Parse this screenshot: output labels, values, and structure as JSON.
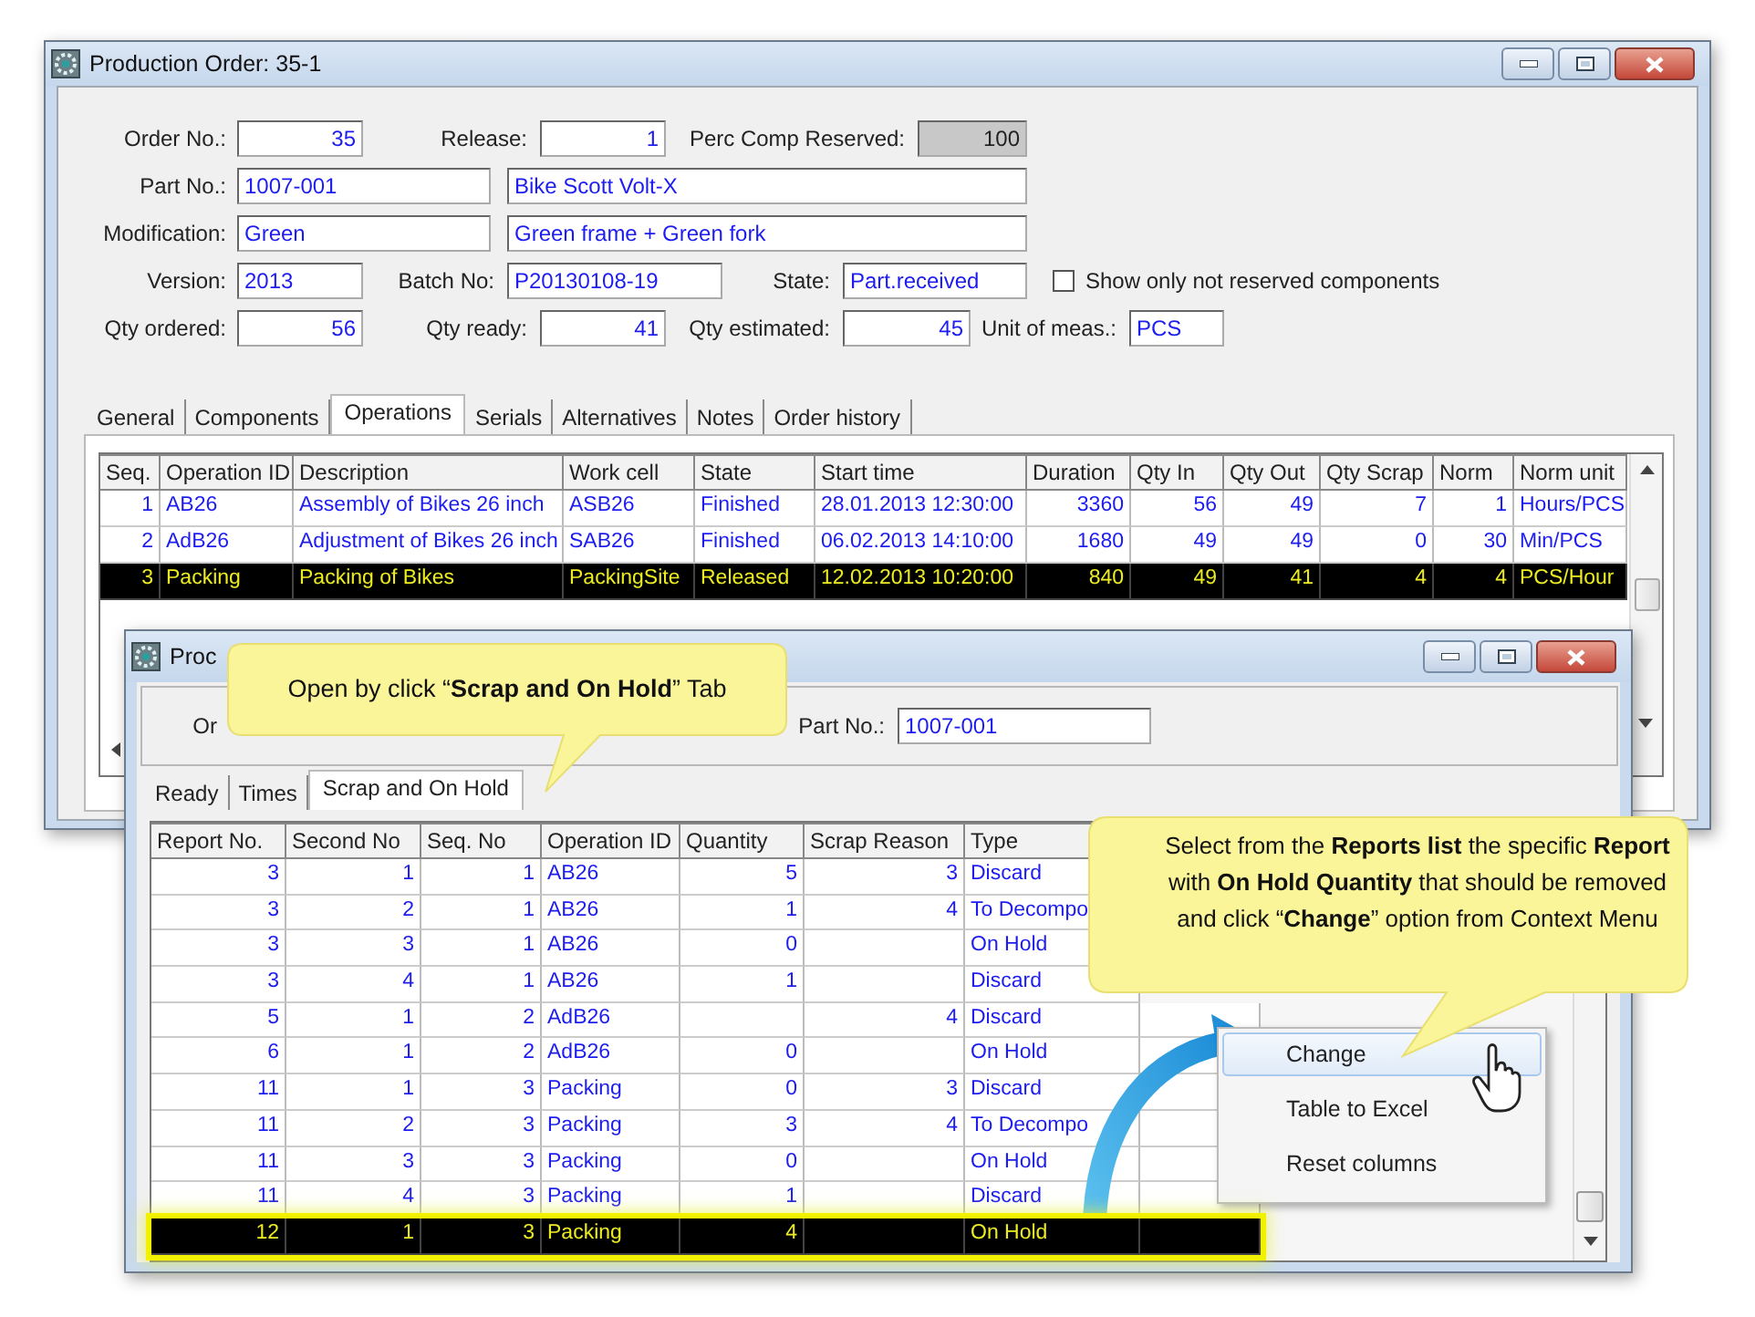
{
  "main_window": {
    "title": "Production Order: 35-1",
    "form": [
      [
        {
          "kind": "label",
          "text": "Order No.:"
        },
        {
          "kind": "field",
          "value": "35",
          "readonly": false
        },
        {
          "kind": "label",
          "text": "Release:"
        },
        {
          "kind": "field",
          "value": "1",
          "readonly": false
        },
        {
          "kind": "label",
          "text": "Perc Comp Reserved:"
        },
        {
          "kind": "field",
          "value": "100",
          "readonly": true
        }
      ],
      [
        {
          "kind": "label",
          "text": "Part No.:"
        },
        {
          "kind": "field",
          "value": "1007-001",
          "readonly": false
        },
        {
          "kind": "field",
          "value": "Bike Scott Volt-X",
          "readonly": false
        }
      ],
      [
        {
          "kind": "label",
          "text": "Modification:"
        },
        {
          "kind": "field",
          "value": "Green",
          "readonly": false
        },
        {
          "kind": "field",
          "value": "Green frame + Green fork",
          "readonly": false
        }
      ],
      [
        {
          "kind": "label",
          "text": "Version:"
        },
        {
          "kind": "field",
          "value": "2013",
          "readonly": false
        },
        {
          "kind": "label",
          "text": "Batch No:"
        },
        {
          "kind": "field",
          "value": "P20130108-19",
          "readonly": false
        },
        {
          "kind": "label",
          "text": "State:"
        },
        {
          "kind": "field",
          "value": "Part.received",
          "readonly": false
        },
        {
          "kind": "checkbox",
          "label": "Show only not reserved components",
          "checked": false
        }
      ],
      [
        {
          "kind": "label",
          "text": "Qty ordered:"
        },
        {
          "kind": "field",
          "value": "56",
          "readonly": false
        },
        {
          "kind": "label",
          "text": "Qty ready:"
        },
        {
          "kind": "field",
          "value": "41",
          "readonly": false
        },
        {
          "kind": "label",
          "text": "Qty estimated:"
        },
        {
          "kind": "field",
          "value": "45",
          "readonly": false
        },
        {
          "kind": "label",
          "text": "Unit of meas.:"
        },
        {
          "kind": "field",
          "value": "PCS",
          "readonly": false
        }
      ]
    ],
    "tabs": [
      {
        "label": "General",
        "selected": false
      },
      {
        "label": "Components",
        "selected": false
      },
      {
        "label": "Operations",
        "selected": true
      },
      {
        "label": "Serials",
        "selected": false
      },
      {
        "label": "Alternatives",
        "selected": false
      },
      {
        "label": "Notes",
        "selected": false
      },
      {
        "label": "Order history",
        "selected": false
      }
    ],
    "table": {
      "columns": [
        "Seq.",
        "Operation ID",
        "Description",
        "Work cell",
        "State",
        "Start time",
        "Duration",
        "Qty In",
        "Qty Out",
        "Qty Scrap",
        "Norm",
        "Norm unit"
      ],
      "rows": [
        {
          "cells": [
            "1",
            "AB26",
            "Assembly of Bikes 26 inch",
            "ASB26",
            "Finished",
            "28.01.2013 12:30:00",
            "3360",
            "56",
            "49",
            "7",
            "1",
            "Hours/PCS"
          ],
          "selected": false
        },
        {
          "cells": [
            "2",
            "AdB26",
            "Adjustment of Bikes 26 inch",
            "SAB26",
            "Finished",
            "06.02.2013 14:10:00",
            "1680",
            "49",
            "49",
            "0",
            "30",
            "Min/PCS"
          ],
          "selected": false
        },
        {
          "cells": [
            "3",
            "Packing",
            "Packing of Bikes",
            "PackingSite",
            "Released",
            "12.02.2013 10:20:00",
            "840",
            "49",
            "41",
            "4",
            "4",
            "PCS/Hour"
          ],
          "selected": true
        }
      ]
    }
  },
  "reports_window": {
    "title": "Proc",
    "form": [
      {
        "kind": "label",
        "text": "Or"
      },
      {
        "kind": "label",
        "text": "Part No.:"
      },
      {
        "kind": "field",
        "value": "1007-001"
      }
    ],
    "tabs": [
      {
        "label": "Ready",
        "selected": false
      },
      {
        "label": "Times",
        "selected": false
      },
      {
        "label": "Scrap and On Hold",
        "selected": true
      }
    ],
    "table": {
      "columns": [
        "Report No.",
        "Second No",
        "Seq. No",
        "Operation ID",
        "Quantity",
        "Scrap Reason",
        "Type"
      ],
      "rows": [
        {
          "cells": [
            "3",
            "1",
            "1",
            "AB26",
            "5",
            "3",
            "Discard"
          ],
          "selected": false
        },
        {
          "cells": [
            "3",
            "2",
            "1",
            "AB26",
            "1",
            "4",
            "To Decompo"
          ],
          "selected": false
        },
        {
          "cells": [
            "3",
            "3",
            "1",
            "AB26",
            "0",
            null,
            "On Hold"
          ],
          "selected": false
        },
        {
          "cells": [
            "3",
            "4",
            "1",
            "AB26",
            "1",
            null,
            "Discard"
          ],
          "selected": false
        },
        {
          "cells": [
            "5",
            "1",
            "2",
            "AdB26",
            null,
            "4",
            "Discard"
          ],
          "selected": false
        },
        {
          "cells": [
            "6",
            "1",
            "2",
            "AdB26",
            "0",
            null,
            "On Hold"
          ],
          "selected": false
        },
        {
          "cells": [
            "11",
            "1",
            "3",
            "Packing",
            "0",
            "3",
            "Discard"
          ],
          "selected": false
        },
        {
          "cells": [
            "11",
            "2",
            "3",
            "Packing",
            "3",
            "4",
            "To Decompo"
          ],
          "selected": false
        },
        {
          "cells": [
            "11",
            "3",
            "3",
            "Packing",
            "0",
            null,
            "On Hold"
          ],
          "selected": false
        },
        {
          "cells": [
            "11",
            "4",
            "3",
            "Packing",
            "1",
            null,
            "Discard"
          ],
          "selected": false
        },
        {
          "cells": [
            "12",
            "1",
            "3",
            "Packing",
            "4",
            null,
            "On Hold"
          ],
          "selected": true
        }
      ]
    }
  },
  "context_menu": {
    "items": [
      {
        "label": "Change",
        "selected": true
      },
      {
        "label": "Table to Excel",
        "selected": false
      },
      {
        "label": "Reset columns",
        "selected": false
      }
    ]
  },
  "callouts": [
    {
      "text": "Open by click “**Scrap and On Hold**” Tab"
    },
    {
      "text": "Select from the **Reports list** the specific **Report** with **On Hold Quantity** that should be removed and click “**Change**” option from Context Menu"
    }
  ]
}
